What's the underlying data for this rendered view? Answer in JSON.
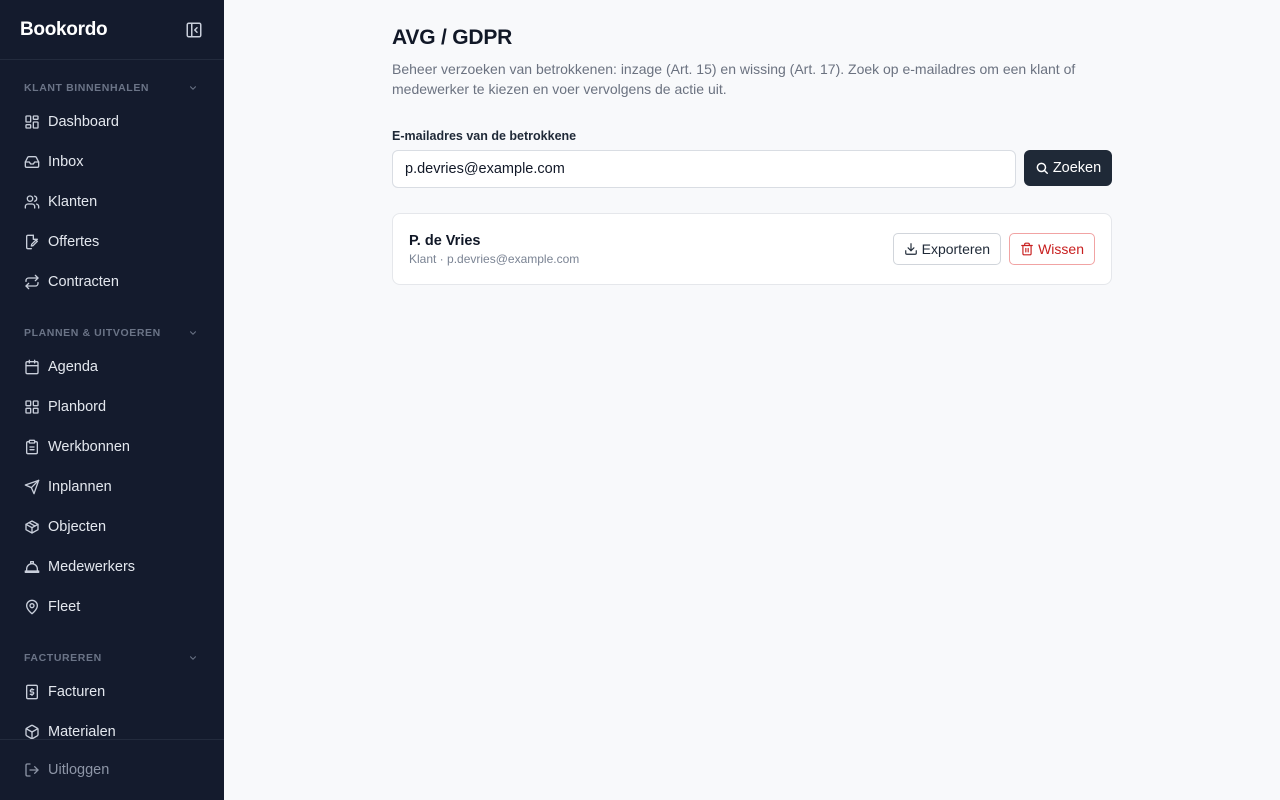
{
  "app": {
    "brand": "Bookordo"
  },
  "sidebar": {
    "sections": [
      {
        "title": "KLANT BINNENHALEN",
        "items": [
          {
            "label": "Dashboard",
            "icon": "dashboard-icon"
          },
          {
            "label": "Inbox",
            "icon": "inbox-icon"
          },
          {
            "label": "Klanten",
            "icon": "users-icon"
          },
          {
            "label": "Offertes",
            "icon": "file-edit-icon"
          },
          {
            "label": "Contracten",
            "icon": "repeat-icon"
          }
        ]
      },
      {
        "title": "PLANNEN & UITVOEREN",
        "items": [
          {
            "label": "Agenda",
            "icon": "calendar-icon"
          },
          {
            "label": "Planbord",
            "icon": "grid-icon"
          },
          {
            "label": "Werkbonnen",
            "icon": "clipboard-icon"
          },
          {
            "label": "Inplannen",
            "icon": "send-icon"
          },
          {
            "label": "Objecten",
            "icon": "boxes-icon"
          },
          {
            "label": "Medewerkers",
            "icon": "hard-hat-icon"
          },
          {
            "label": "Fleet",
            "icon": "map-pin-icon"
          }
        ]
      },
      {
        "title": "FACTUREREN",
        "items": [
          {
            "label": "Facturen",
            "icon": "dollar-file-icon"
          },
          {
            "label": "Materialen",
            "icon": "package-icon"
          }
        ]
      }
    ],
    "logout_label": "Uitloggen"
  },
  "main": {
    "title": "AVG / GDPR",
    "description": "Beheer verzoeken van betrokkenen: inzage (Art. 15) en wissing (Art. 17). Zoek op e-mailadres om een klant of medewerker te kiezen en voer vervolgens de actie uit.",
    "email_label": "E-mailadres van de betrokkene",
    "email_value": "p.devries@example.com",
    "search_label": "Zoeken",
    "result": {
      "name": "P. de Vries",
      "meta": "Klant · p.devries@example.com",
      "export_label": "Exporteren",
      "delete_label": "Wissen"
    }
  },
  "colors": {
    "sidebar_bg": "#141b2d",
    "primary_btn": "#1f2937",
    "danger": "#c81e1e"
  }
}
